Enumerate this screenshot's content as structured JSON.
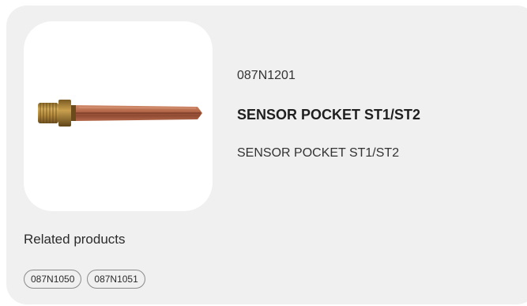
{
  "product": {
    "code": "087N1201",
    "title": "SENSOR POCKET ST1/ST2",
    "description": "SENSOR POCKET ST1/ST2",
    "image_icon": "sensor-pocket-image"
  },
  "related": {
    "heading": "Related products",
    "items": [
      {
        "label": "087N1050"
      },
      {
        "label": "087N1051"
      }
    ]
  },
  "colors": {
    "card_background": "#f0f0f0",
    "image_background": "#ffffff",
    "chip_border": "#8a8a8a",
    "copper": "#b0674a",
    "brass": "#b58a3c"
  }
}
